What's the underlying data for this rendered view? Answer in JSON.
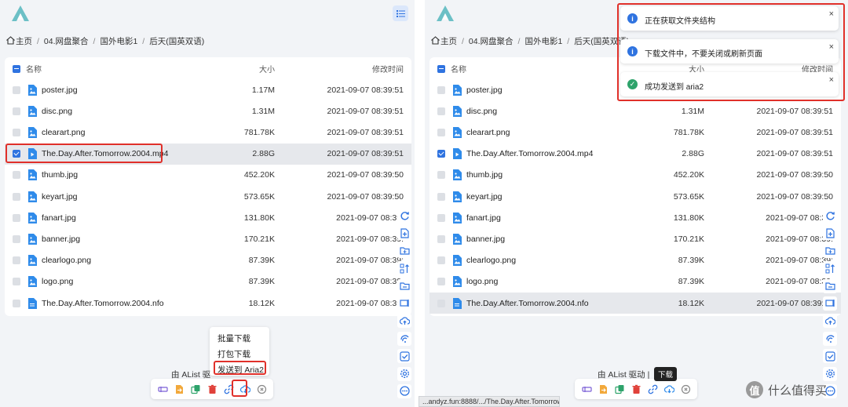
{
  "breadcrumb": [
    "主页",
    "04.网盘聚合",
    "国外电影1",
    "后天(国英双语)"
  ],
  "table": {
    "columns": [
      "名称",
      "大小",
      "修改时间"
    ],
    "rows": [
      {
        "name": "poster.jpg",
        "size": "1.17M",
        "time": "2021-09-07 08:39:51",
        "type": "image"
      },
      {
        "name": "disc.png",
        "size": "1.31M",
        "time": "2021-09-07 08:39:51",
        "type": "image"
      },
      {
        "name": "clearart.png",
        "size": "781.78K",
        "time": "2021-09-07 08:39:51",
        "type": "image"
      },
      {
        "name": "The.Day.After.Tomorrow.2004.mp4",
        "size": "2.88G",
        "time": "2021-09-07 08:39:51",
        "type": "video"
      },
      {
        "name": "thumb.jpg",
        "size": "452.20K",
        "time": "2021-09-07 08:39:50",
        "type": "image"
      },
      {
        "name": "keyart.jpg",
        "size": "573.65K",
        "time": "2021-09-07 08:39:50",
        "type": "image"
      },
      {
        "name": "fanart.jpg",
        "size": "131.80K",
        "time": "2021-09-07 08:39:",
        "type": "image"
      },
      {
        "name": "banner.jpg",
        "size": "170.21K",
        "time": "2021-09-07 08:39:",
        "type": "image"
      },
      {
        "name": "clearlogo.png",
        "size": "87.39K",
        "time": "2021-09-07 08:39:",
        "type": "image"
      },
      {
        "name": "logo.png",
        "size": "87.39K",
        "time": "2021-09-07 08:39:",
        "type": "image"
      },
      {
        "name": "The.Day.After.Tomorrow.2004.nfo",
        "size": "18.12K",
        "time": "2021-09-07 08:39:",
        "type": "doc"
      }
    ]
  },
  "right_table": {
    "rows": [
      {
        "name": "poster.jpg",
        "size": "",
        "time": "",
        "type": "image"
      },
      {
        "name": "disc.png",
        "size": "1.31M",
        "time": "2021-09-07 08:39:51",
        "type": "image"
      },
      {
        "name": "clearart.png",
        "size": "781.78K",
        "time": "2021-09-07 08:39:51",
        "type": "image"
      },
      {
        "name": "The.Day.After.Tomorrow.2004.mp4",
        "size": "2.88G",
        "time": "2021-09-07 08:39:51",
        "type": "video"
      },
      {
        "name": "thumb.jpg",
        "size": "452.20K",
        "time": "2021-09-07 08:39:50",
        "type": "image"
      },
      {
        "name": "keyart.jpg",
        "size": "573.65K",
        "time": "2021-09-07 08:39:50",
        "type": "image"
      },
      {
        "name": "fanart.jpg",
        "size": "131.80K",
        "time": "2021-09-07 08:39:",
        "type": "image"
      },
      {
        "name": "banner.jpg",
        "size": "170.21K",
        "time": "2021-09-07 08:39:",
        "type": "image"
      },
      {
        "name": "clearlogo.png",
        "size": "87.39K",
        "time": "2021-09-07 08:39:",
        "type": "image"
      },
      {
        "name": "logo.png",
        "size": "87.39K",
        "time": "2021-09-07 08:39:",
        "type": "image"
      },
      {
        "name": "The.Day.After.Tomorrow.2004.nfo",
        "size": "18.12K",
        "time": "2021-09-07 08:39:",
        "type": "doc"
      }
    ],
    "header_size_partial": "大小",
    "header_time_partial": "修改时间",
    "last_row_time_full": "2021-09-07 08:39:51"
  },
  "menu": {
    "items": [
      "批量下载",
      "打包下载",
      "发送到 Aria2"
    ]
  },
  "footer": {
    "left_text": "由 AList 驱",
    "right_text": "由 AList 驱动 |"
  },
  "tooltip": "下载",
  "status_url": "...andyz.fun:8888/.../The.Day.After.Tomorrow....",
  "toasts": [
    {
      "text": "正在获取文件夹结构",
      "kind": "info",
      "close": "×"
    },
    {
      "text": "下载文件中，不要关闭或刷新页面",
      "kind": "info",
      "close": "×"
    },
    {
      "text": "成功发送到 aria2",
      "kind": "success",
      "close": "×"
    }
  ],
  "watermark": {
    "text": "什么值得买",
    "badge": "值"
  },
  "colors": {
    "accent": "#2f73e0",
    "highlight_box": "#e0302a",
    "success": "#2ea36b",
    "info": "#2f73e0"
  }
}
